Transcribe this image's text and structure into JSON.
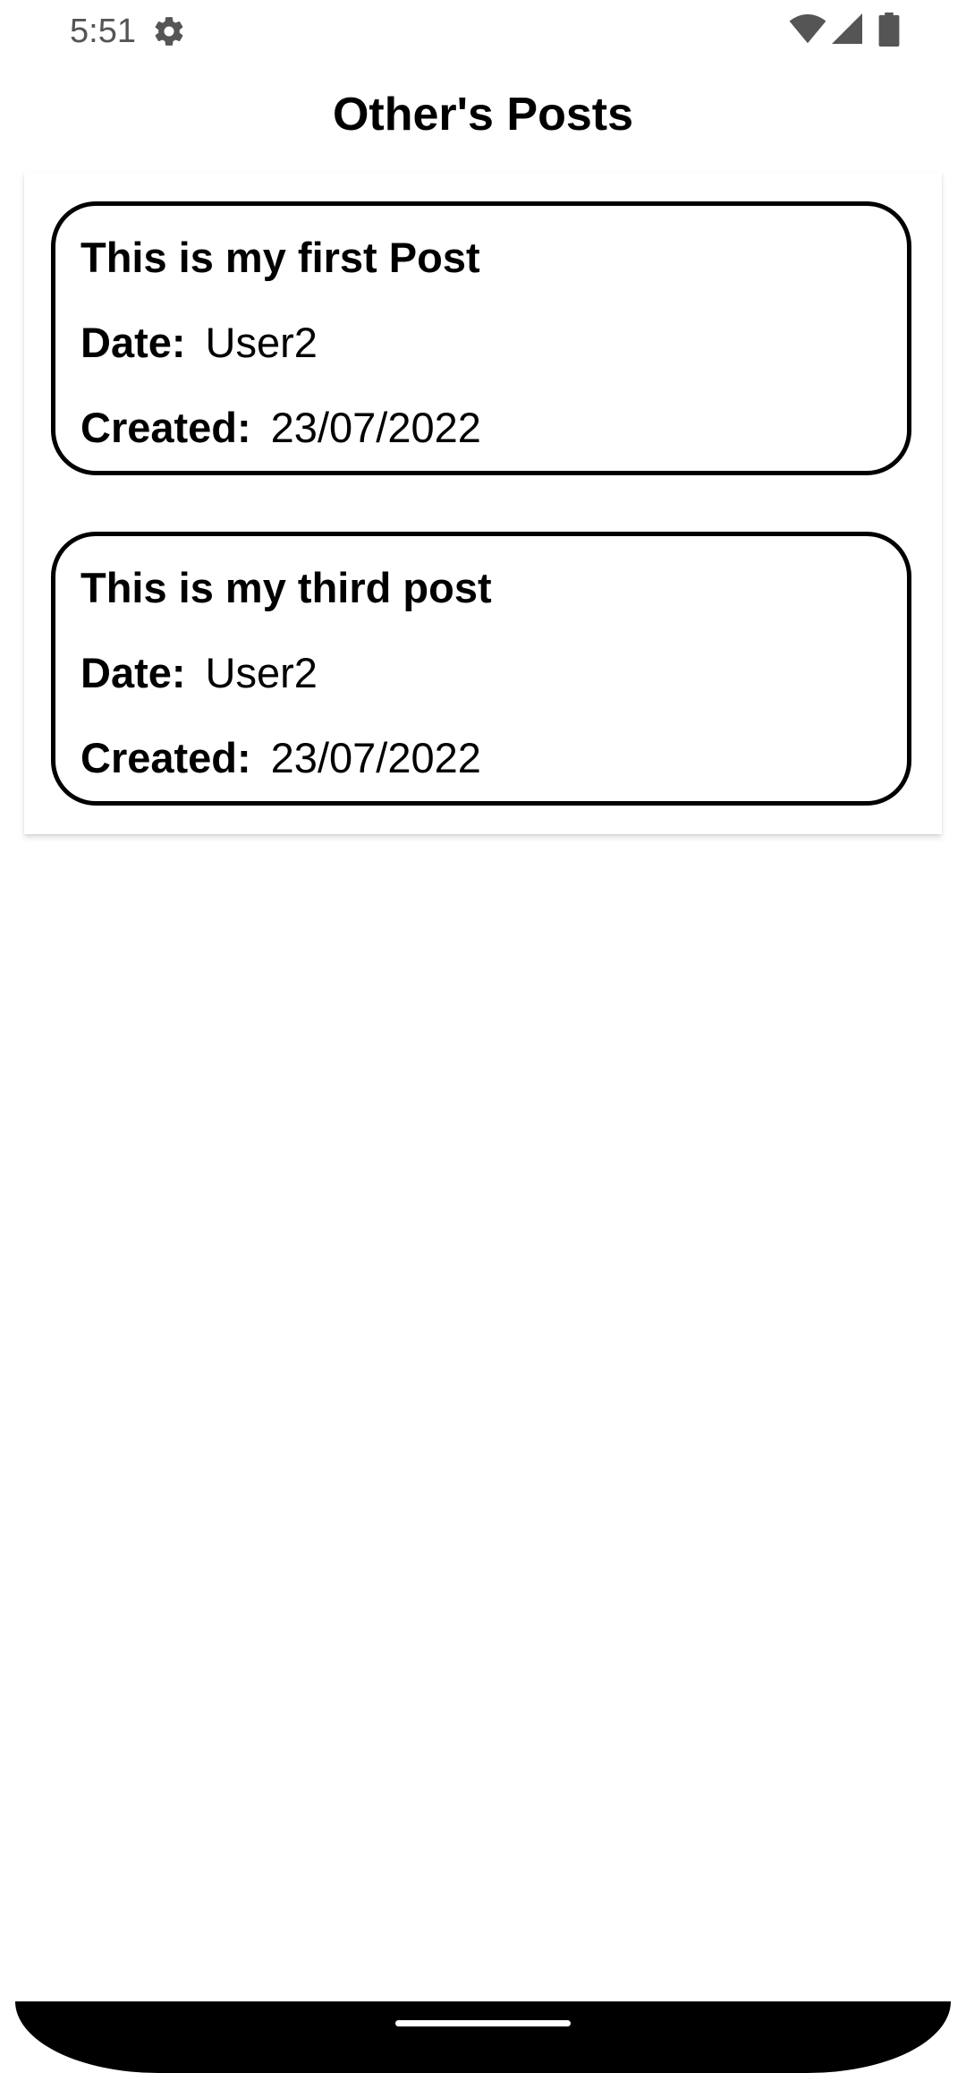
{
  "status_bar": {
    "time": "5:51",
    "icons": [
      "gear-icon",
      "wifi-icon",
      "signal-icon",
      "battery-icon"
    ]
  },
  "header": {
    "title": "Other's Posts"
  },
  "posts": [
    {
      "title": "This is my first Post",
      "date_label": "Date:",
      "date_value": "User2",
      "created_label": "Created:",
      "created_value": "23/07/2022"
    },
    {
      "title": "This is my third post",
      "date_label": "Date:",
      "date_value": "User2",
      "created_label": "Created:",
      "created_value": "23/07/2022"
    }
  ],
  "colors": {
    "background": "#ffffff",
    "text": "#000000",
    "card_border": "#000000"
  }
}
